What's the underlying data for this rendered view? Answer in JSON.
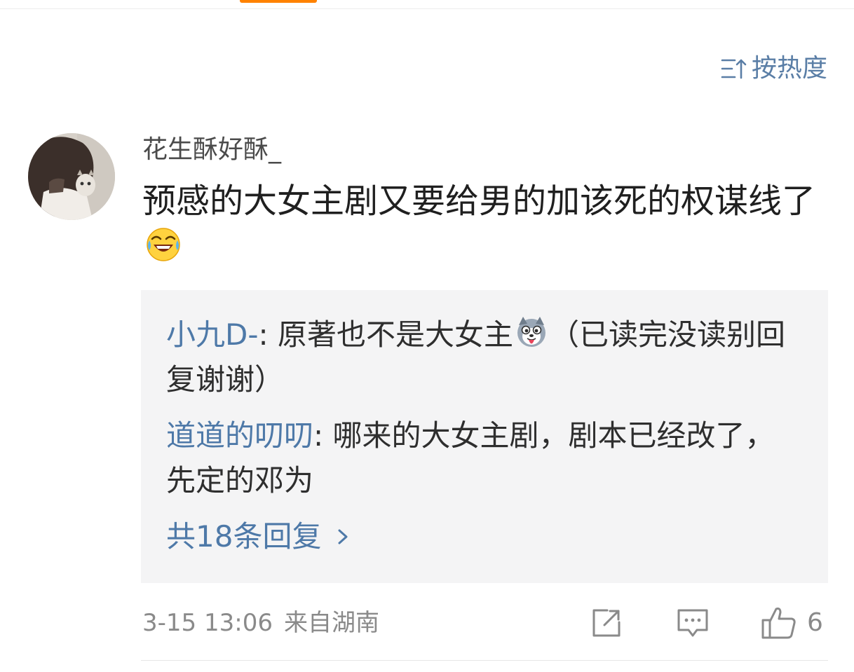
{
  "sort": {
    "label": "按热度"
  },
  "comment": {
    "username": "花生酥好酥_",
    "text": "预感的大女主剧又要给男的加该死的权谋线了"
  },
  "replies": [
    {
      "author": "小九D-",
      "separator": ": ",
      "text_before_emoji": "原著也不是大女主",
      "text_after_emoji": "（已读完没读别回复谢谢）"
    },
    {
      "author": "道道的叨叨",
      "separator": ": ",
      "text": "哪来的大女主剧，剧本已经改了，先定的邓为"
    }
  ],
  "more_replies_label": "共18条回复",
  "footer": {
    "time": "3-15 13:06",
    "location": "来自湖南",
    "like_count": "6"
  },
  "colors": {
    "link_blue": "#4e79a8",
    "sort_blue": "#5a7ea6",
    "accent_orange": "#ff8200",
    "meta_gray": "#8a8a8a"
  },
  "icons": [
    "sort-icon",
    "laugh-cry-emoji-icon",
    "dog-tongue-emoji-icon",
    "chevron-right-icon",
    "share-icon",
    "comment-icon",
    "thumbs-up-icon"
  ]
}
